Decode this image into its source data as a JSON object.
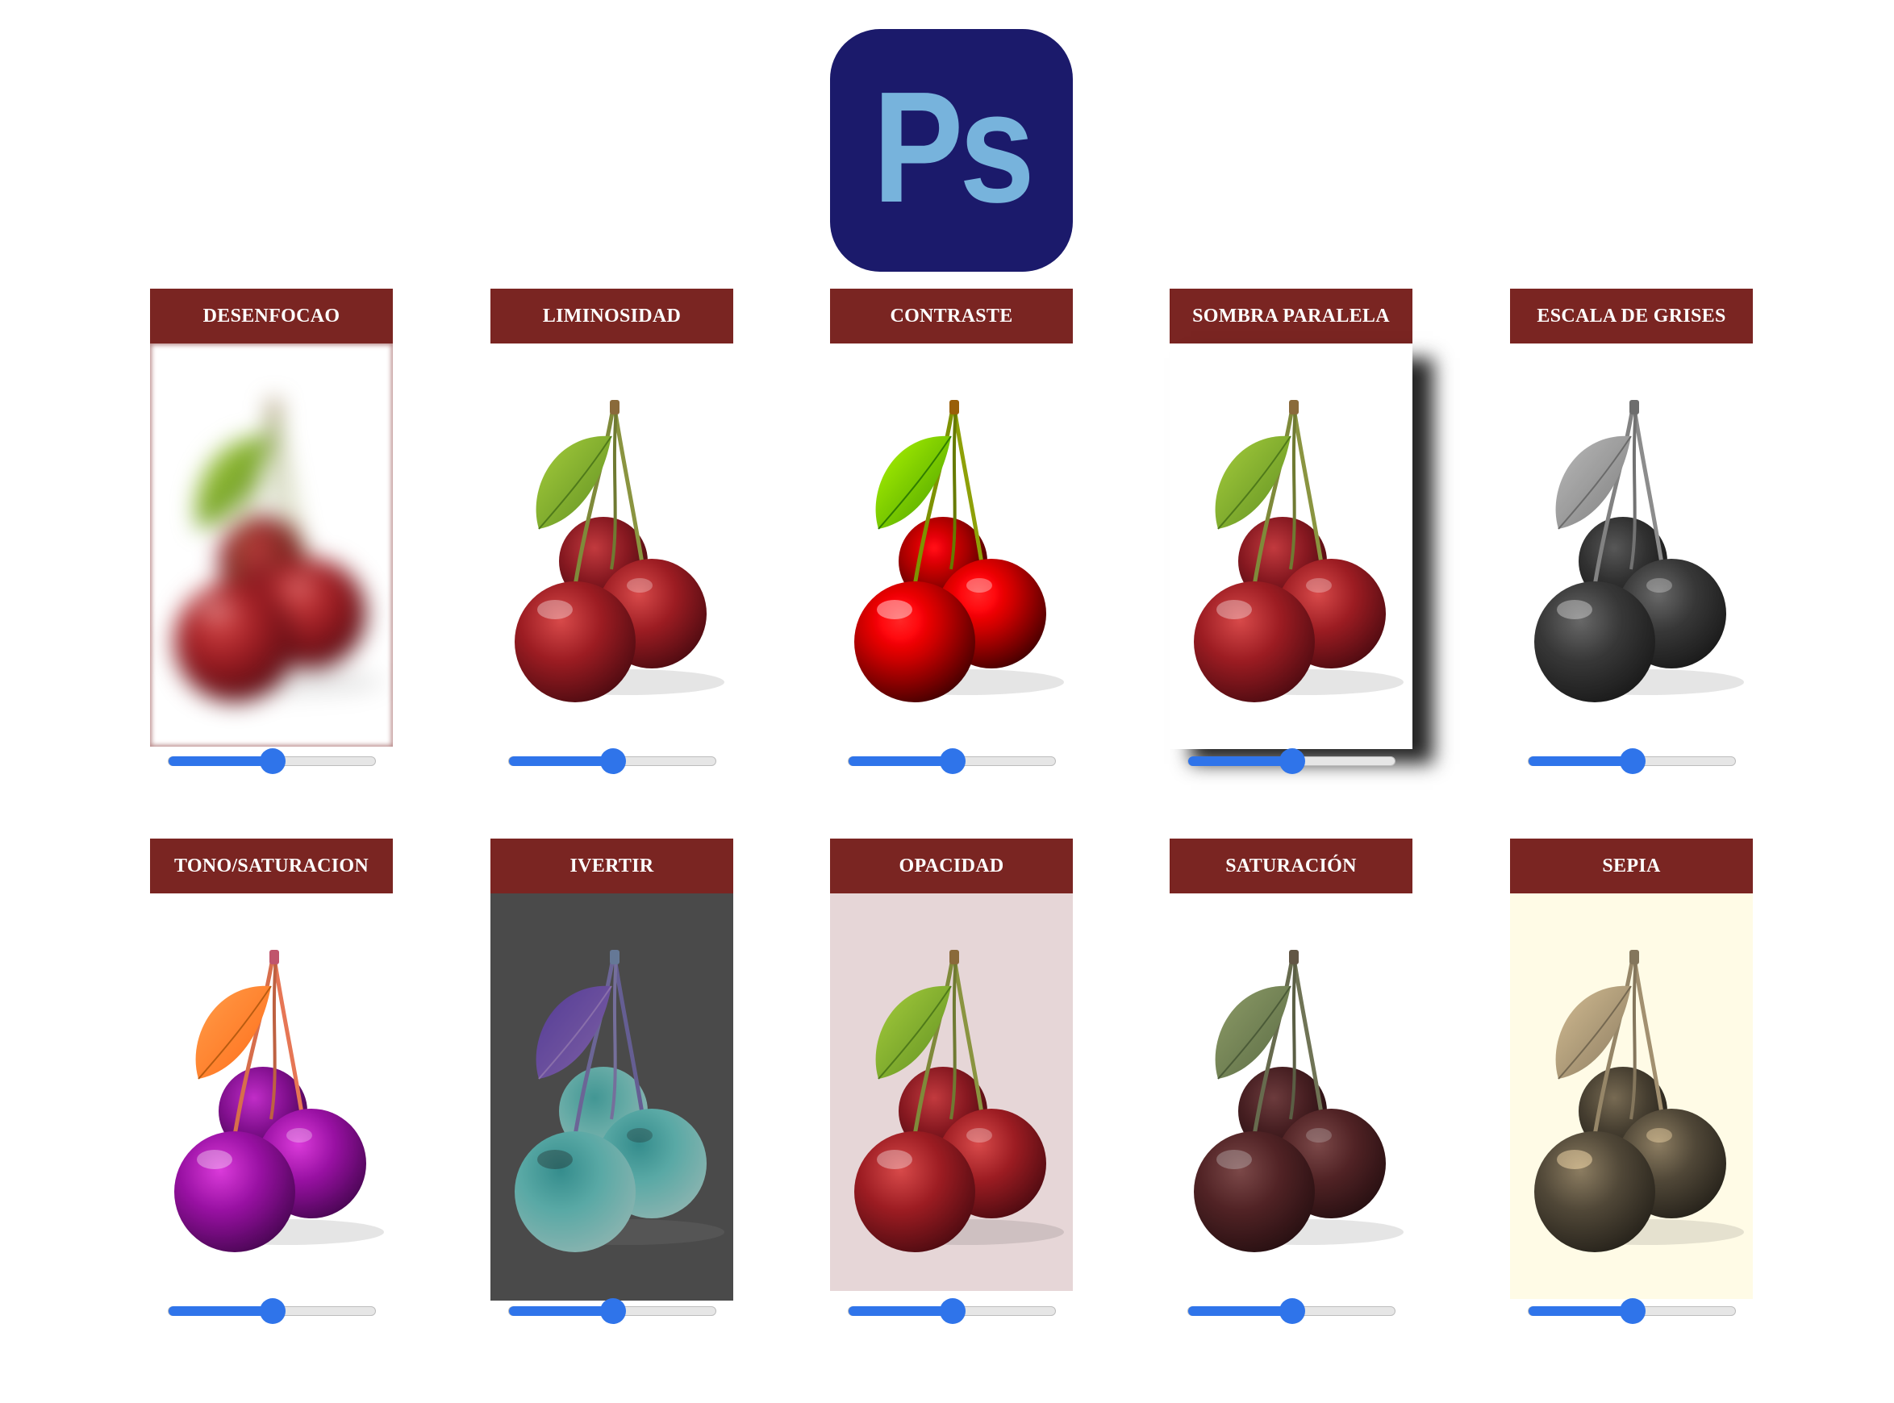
{
  "logo": {
    "text": "Ps",
    "bg": "#1b1a6b",
    "fg": "#77b3dc"
  },
  "accent": "#7a2522",
  "slider_color": "#2f74ea",
  "cards": [
    {
      "title": "DESENFOCAO",
      "slider_value": 0.5
    },
    {
      "title": "LIMINOSIDAD",
      "slider_value": 0.5
    },
    {
      "title": "CONTRASTE",
      "slider_value": 0.5
    },
    {
      "title": "SOMBRA PARALELA",
      "slider_value": 0.5
    },
    {
      "title": "ESCALA DE GRISES",
      "slider_value": 0.5
    },
    {
      "title": "TONO/SATURACION",
      "slider_value": 0.5
    },
    {
      "title": "IVERTIR",
      "slider_value": 0.5
    },
    {
      "title": "OPACIDAD",
      "slider_value": 0.5
    },
    {
      "title": "SATURACIÓN",
      "slider_value": 0.5
    },
    {
      "title": "SEPIA",
      "slider_value": 0.5
    }
  ]
}
